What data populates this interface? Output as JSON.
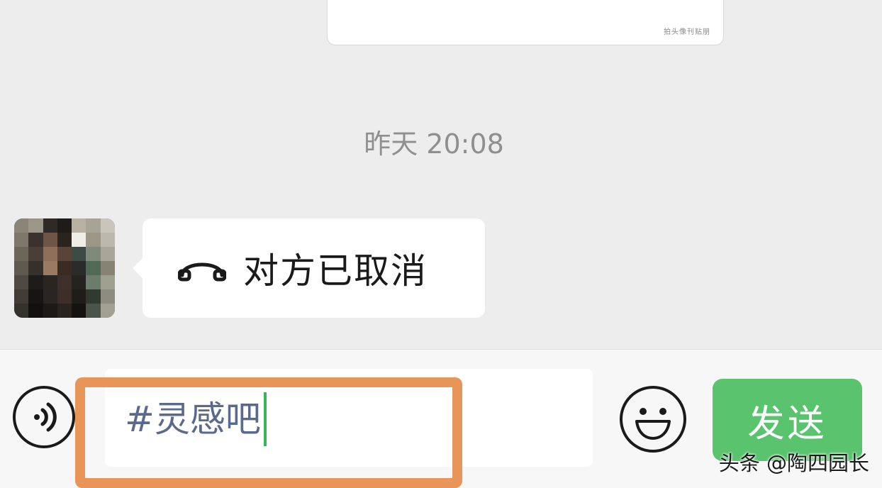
{
  "previous_message": {
    "small_text": "拍头像刊贴朋"
  },
  "timestamp": "昨天 20:08",
  "incoming_message": {
    "icon": "phone-hangup-icon",
    "text": "对方已取消"
  },
  "input_bar": {
    "voice_icon": "voice-input-icon",
    "input_value": "#灵感吧",
    "emoji_icon": "emoji-icon",
    "send_label": "发送"
  },
  "watermark": "头条 @陶四园长",
  "colors": {
    "send_button": "#5ac36e",
    "highlight_box": "#e8955a",
    "caret": "#3bb35a",
    "input_text": "#5a6a8c",
    "timestamp": "#8f8f8f"
  }
}
